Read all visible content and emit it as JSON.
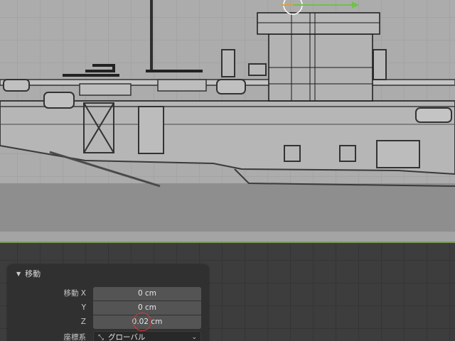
{
  "viewport": {
    "name": "3D Viewport"
  },
  "panel": {
    "title": "移動",
    "rows": [
      {
        "label": "移動 X",
        "value": "0 cm"
      },
      {
        "label": "Y",
        "value": "0 cm"
      },
      {
        "label": "Z",
        "value": "0.02 cm"
      },
      {
        "label": "座標系",
        "value": "グローバル"
      }
    ]
  },
  "icons": {
    "collapse": "triangle-down-icon",
    "orientation": "orientation-global-icon",
    "dropdown": "chevron-down-icon"
  },
  "colors": {
    "gizmo_y_axis": "#6fc24a",
    "gizmo_x_axis": "#d8a23a",
    "highlight_ring": "#d23a3a",
    "ground_line": "#7a9a5a"
  }
}
